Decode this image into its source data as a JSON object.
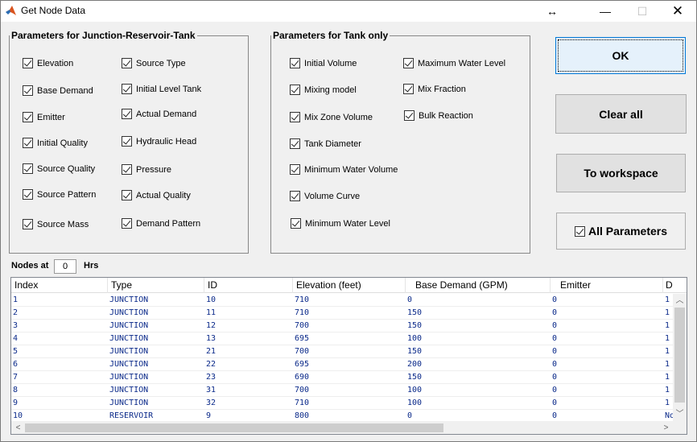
{
  "window": {
    "title": "Get Node Data",
    "resize_glyph": "↔",
    "minimize_glyph": "—",
    "maximize_glyph": "☐",
    "close_glyph": "✕"
  },
  "group_junction": {
    "title": "Parameters for Junction-Reservoir-Tank",
    "checkboxes": [
      {
        "label": "Elevation",
        "checked": true
      },
      {
        "label": "Base Demand",
        "checked": true
      },
      {
        "label": "Emitter",
        "checked": true
      },
      {
        "label": "Initial Quality",
        "checked": true
      },
      {
        "label": "Source Quality",
        "checked": true
      },
      {
        "label": "Source Pattern",
        "checked": true
      },
      {
        "label": "Source Mass",
        "checked": true
      },
      {
        "label": "Source Type",
        "checked": true
      },
      {
        "label": "Initial Level Tank",
        "checked": true
      },
      {
        "label": "Actual Demand",
        "checked": true
      },
      {
        "label": "Hydraulic Head",
        "checked": true
      },
      {
        "label": "Pressure",
        "checked": true
      },
      {
        "label": "Actual Quality",
        "checked": true
      },
      {
        "label": "Demand Pattern",
        "checked": true
      }
    ]
  },
  "group_tank": {
    "title": "Parameters for Tank only",
    "checkboxes": [
      {
        "label": "Initial Volume",
        "checked": true
      },
      {
        "label": "Mixing model",
        "checked": true
      },
      {
        "label": "Mix Zone Volume",
        "checked": true
      },
      {
        "label": "Tank Diameter",
        "checked": true
      },
      {
        "label": "Minimum Water Volume",
        "checked": true
      },
      {
        "label": "Volume Curve",
        "checked": true
      },
      {
        "label": "Minimum Water Level",
        "checked": true
      },
      {
        "label": "Maximum Water Level",
        "checked": true
      },
      {
        "label": "Mix Fraction",
        "checked": true
      },
      {
        "label": "Bulk Reaction",
        "checked": true
      }
    ]
  },
  "buttons": {
    "ok": "OK",
    "clear_all": "Clear all",
    "to_workspace": "To workspace",
    "all_parameters": "All Parameters"
  },
  "nodes_at": {
    "label": "Nodes at",
    "value": "0",
    "unit": "Hrs"
  },
  "table": {
    "columns": [
      "Index",
      "Type",
      "ID",
      "Elevation (feet)",
      "Base Demand (GPM)",
      "Emitter",
      "D"
    ],
    "rows": [
      [
        "1",
        "JUNCTION",
        "10",
        "710",
        "0",
        "0",
        "1"
      ],
      [
        "2",
        "JUNCTION",
        "11",
        "710",
        "150",
        "0",
        "1"
      ],
      [
        "3",
        "JUNCTION",
        "12",
        "700",
        "150",
        "0",
        "1"
      ],
      [
        "4",
        "JUNCTION",
        "13",
        "695",
        "100",
        "0",
        "1"
      ],
      [
        "5",
        "JUNCTION",
        "21",
        "700",
        "150",
        "0",
        "1"
      ],
      [
        "6",
        "JUNCTION",
        "22",
        "695",
        "200",
        "0",
        "1"
      ],
      [
        "7",
        "JUNCTION",
        "23",
        "690",
        "150",
        "0",
        "1"
      ],
      [
        "8",
        "JUNCTION",
        "31",
        "700",
        "100",
        "0",
        "1"
      ],
      [
        "9",
        "JUNCTION",
        "32",
        "710",
        "100",
        "0",
        "1"
      ],
      [
        "10",
        "RESERVOIR",
        "9",
        "800",
        "0",
        "0",
        "No"
      ]
    ],
    "scroll_up_glyph": "︿",
    "scroll_down_glyph": "﹀",
    "scroll_left_glyph": "<",
    "scroll_right_glyph": ">"
  }
}
